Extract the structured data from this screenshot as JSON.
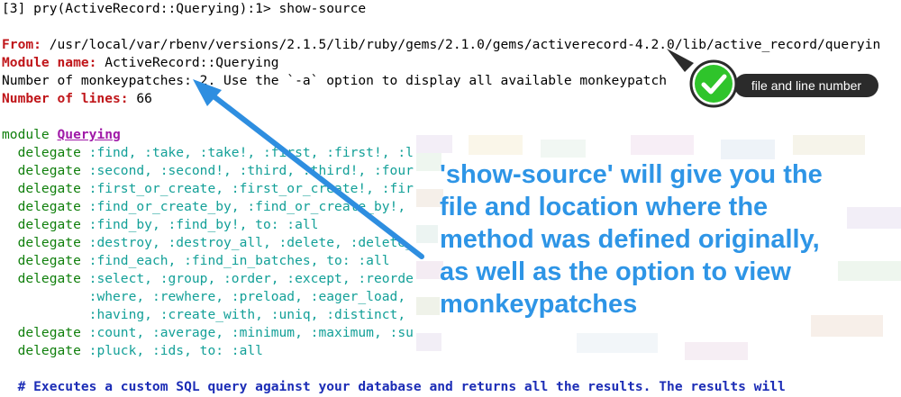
{
  "terminal": {
    "prompt_line": "[3] pry(ActiveRecord::Querying):1> show-source",
    "from_label": "From:",
    "from_value": " /usr/local/var/rbenv/versions/2.1.5/lib/ruby/gems/2.1.0/gems/activerecord-4.2.0/lib/active_record/queryin",
    "module_label": "Module name:",
    "module_value": " ActiveRecord::Querying",
    "monkeypatch_line": "Number of monkeypatches: 2. Use the `-a` option to display all available monkeypatch",
    "lines_label": "Number of lines:",
    "lines_value": " 66",
    "module_kw": "module ",
    "module_name": "Querying",
    "code": [
      {
        "kw": "  delegate ",
        "syms": ":find, :take, :take!, :first, :first!, :l"
      },
      {
        "kw": "  delegate ",
        "syms": ":second, :second!, :third, :third!, :four"
      },
      {
        "kw": "  delegate ",
        "syms": ":first_or_create, :first_or_create!, :fir"
      },
      {
        "kw": "  delegate ",
        "syms": ":find_or_create_by, :find_or_create_by!,"
      },
      {
        "kw": "  delegate ",
        "syms": ":find_by, :find_by!, to: :all"
      },
      {
        "kw": "  delegate ",
        "syms": ":destroy, :destroy_all, :delete, :delete_"
      },
      {
        "kw": "  delegate ",
        "syms": ":find_each, :find_in_batches, to: :all"
      },
      {
        "kw": "  delegate ",
        "syms": ":select, :group, :order, :except, :reorde"
      },
      {
        "kw": "           ",
        "syms": ":where, :rewhere, :preload, :eager_load,"
      },
      {
        "kw": "           ",
        "syms": ":having, :create_with, :uniq, :distinct,"
      },
      {
        "kw": "  delegate ",
        "syms": ":count, :average, :minimum, :maximum, :su"
      },
      {
        "kw": "  delegate ",
        "syms": ":pluck, :ids, to: :all"
      }
    ],
    "comment_line": "  # Executes a custom SQL query against your database and returns all the results. The results will"
  },
  "annotation": {
    "badge_label": "file and line number",
    "callout": [
      "'show-source' will give you the",
      "file and location where the",
      "method was defined originally,",
      "as well as the option to view",
      "monkeypatches"
    ],
    "colors": {
      "callout_blue": "#2e95e6",
      "badge_green": "#2fc42b",
      "pill_dark": "#2b2b2b",
      "arrow_blue": "#2e8ee0"
    }
  }
}
